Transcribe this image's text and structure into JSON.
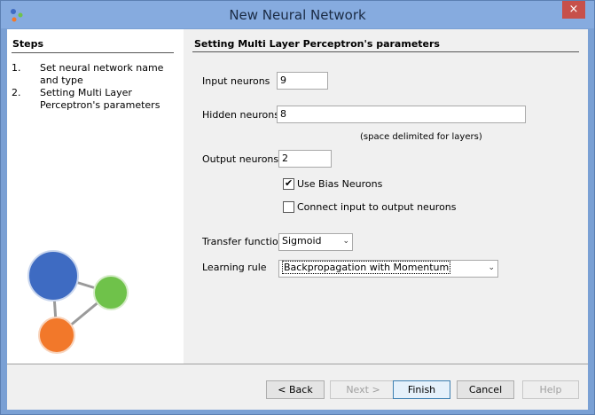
{
  "window": {
    "title": "New Neural Network",
    "close_glyph": "×",
    "app_icon": "app-logo-icon"
  },
  "steps": {
    "title": "Steps",
    "items": [
      {
        "num": "1.",
        "text": "Set neural network name and type"
      },
      {
        "num": "2.",
        "text": "Setting Multi Layer Perceptron's parameters"
      }
    ]
  },
  "section": {
    "title": "Setting Multi Layer Perceptron's parameters"
  },
  "form": {
    "input_neurons_label": "Input neurons",
    "input_neurons_value": "9",
    "hidden_neurons_label": "Hidden neurons",
    "hidden_neurons_value": "8",
    "hidden_hint": "(space delimited for layers)",
    "output_neurons_label": "Output neurons",
    "output_neurons_value": "2",
    "use_bias_label": "Use Bias Neurons",
    "use_bias_checked": true,
    "connect_io_label": "Connect input to output neurons",
    "connect_io_checked": false,
    "transfer_label": "Transfer function",
    "transfer_value": "Sigmoid",
    "learning_label": "Learning rule",
    "learning_value": "Backpropagation with Momentum"
  },
  "buttons": {
    "back": "< Back",
    "next": "Next >",
    "finish": "Finish",
    "cancel": "Cancel",
    "help": "Help"
  },
  "colors": {
    "window_frame": "#7aa0d4",
    "close_button": "#c7504a",
    "node_blue": "#3e6bc2",
    "node_green": "#6fc24a",
    "node_orange": "#f2782a"
  }
}
